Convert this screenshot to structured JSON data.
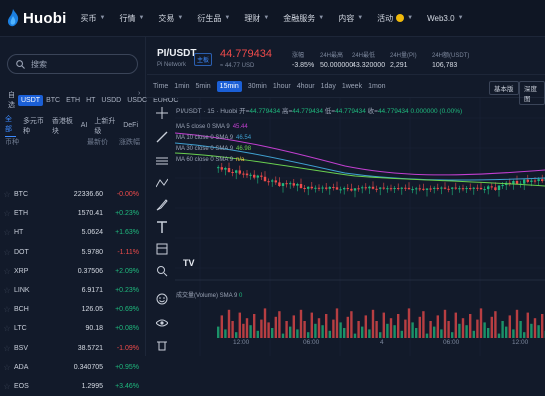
{
  "app": {
    "logo_text": "Huobi"
  },
  "nav": [
    {
      "label": "买币",
      "caret": true
    },
    {
      "label": "行情",
      "caret": true
    },
    {
      "label": "交易",
      "caret": true
    },
    {
      "label": "衍生品",
      "caret": true
    },
    {
      "label": "理财",
      "caret": true
    },
    {
      "label": "金融服务",
      "caret": true
    },
    {
      "label": "内容",
      "caret": true
    },
    {
      "label": "活动",
      "caret": true,
      "badge": true
    },
    {
      "label": "Web3.0",
      "caret": true
    }
  ],
  "sidebar": {
    "search_placeholder": "搜索",
    "quote_tabs": [
      "自选",
      "USDT",
      "BTC",
      "ETH",
      "HT",
      "USDD",
      "USDC",
      "EUROC"
    ],
    "quote_tab_active": 1,
    "sub_tabs": [
      "全部",
      "多元币种",
      "香港板块",
      "AI",
      "上新升级",
      "DeFi"
    ],
    "sub_tab_active": 0,
    "list_headers": {
      "coin": "币种",
      "price": "最新价",
      "change": "涨跌幅"
    },
    "coins": [
      {
        "symbol": "BTC",
        "price": "22336.60",
        "change": "-0.00%",
        "dir": "down"
      },
      {
        "symbol": "ETH",
        "price": "1570.41",
        "change": "+0.23%",
        "dir": "up"
      },
      {
        "symbol": "HT",
        "price": "5.0624",
        "change": "+1.63%",
        "dir": "up"
      },
      {
        "symbol": "DOT",
        "price": "5.9780",
        "change": "-1.11%",
        "dir": "down"
      },
      {
        "symbol": "XRP",
        "price": "0.37506",
        "change": "+2.09%",
        "dir": "up"
      },
      {
        "symbol": "LINK",
        "price": "6.9171",
        "change": "+0.23%",
        "dir": "up"
      },
      {
        "symbol": "BCH",
        "price": "126.05",
        "change": "+0.69%",
        "dir": "up"
      },
      {
        "symbol": "LTC",
        "price": "90.18",
        "change": "+0.08%",
        "dir": "up"
      },
      {
        "symbol": "BSV",
        "price": "38.5721",
        "change": "-1.09%",
        "dir": "down"
      },
      {
        "symbol": "ADA",
        "price": "0.340705",
        "change": "+0.95%",
        "dir": "up"
      },
      {
        "symbol": "EOS",
        "price": "1.2995",
        "change": "+3.46%",
        "dir": "up"
      }
    ]
  },
  "header": {
    "pair": "PI/USDT",
    "network": "Pi Network",
    "tag": "主板",
    "price": "44.779434",
    "price_sub": "≈ 44.77 USD",
    "stats": [
      {
        "label": "涨幅",
        "value": "-3.85%",
        "dir": "down"
      },
      {
        "label": "24H最高",
        "value": "50.000000"
      },
      {
        "label": "24H最低",
        "value": "43.320000"
      },
      {
        "label": "24H量(PI)",
        "value": "2,291"
      },
      {
        "label": "24H额(USDT)",
        "value": "106,783"
      }
    ]
  },
  "toolbar": {
    "timeframes": [
      "Time",
      "1min",
      "5min",
      "15min",
      "30min",
      "1hour",
      "4hour",
      "1day",
      "1week",
      "1mon"
    ],
    "active": 3,
    "basic_label": "基本版",
    "depth_label": "深度图"
  },
  "chart": {
    "ohlc_text": "PI/USDT · 15 · Huobi",
    "open_label": "开=",
    "open": "44.779434",
    "high_label": "高=",
    "high": "44.779434",
    "low_label": "低=",
    "low": "44.779434",
    "close_label": "收=",
    "close": "44.779434",
    "delta": "0.000000 (0.00%)",
    "ma_lines": [
      {
        "text": "MA 5 close 0 SMA 9",
        "value": "45.44",
        "color": "#c23fd0"
      },
      {
        "text": "MA 10 close 0 SMA 9",
        "value": "46.54",
        "color": "#3fa0d0"
      },
      {
        "text": "MA 30 close 0 SMA 9",
        "value": "46.98",
        "color": "#6ad04f"
      },
      {
        "text": "MA 60 close 0 SMA 9",
        "value": "n/a",
        "color": "#f0c040"
      }
    ],
    "volume_label": "成交量(Volume) SMA 9",
    "volume_value": "0",
    "x_ticks": [
      "12:00",
      "06:00",
      "4",
      "06:00",
      "12:00"
    ],
    "tv_logo": "TV"
  },
  "colors": {
    "up": "#1fba7e",
    "down": "#ef4b4b",
    "accent": "#1b5fd6"
  }
}
